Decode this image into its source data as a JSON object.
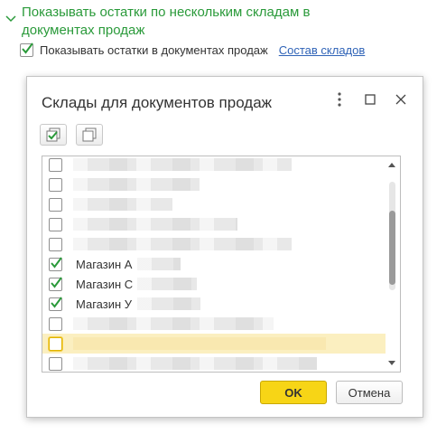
{
  "section": {
    "title": "Показывать остатки по нескольким складам в документах продаж",
    "expanded": true
  },
  "option": {
    "checked": true,
    "label": "Показывать остатки в документах продаж",
    "link": "Состав складов"
  },
  "dialog": {
    "title": "Склады для документов продаж",
    "toolbar": [
      "check-all-icon",
      "uncheck-all-icon"
    ],
    "rows": [
      {
        "checked": false,
        "label": ""
      },
      {
        "checked": false,
        "label": ""
      },
      {
        "checked": false,
        "label": ""
      },
      {
        "checked": false,
        "label": ""
      },
      {
        "checked": false,
        "label": ""
      },
      {
        "checked": true,
        "label": "Магазин А"
      },
      {
        "checked": true,
        "label": "Магазин С"
      },
      {
        "checked": true,
        "label": "Магазин У"
      },
      {
        "checked": false,
        "label": ""
      },
      {
        "checked": false,
        "label": "",
        "selected": true
      },
      {
        "checked": false,
        "label": ""
      }
    ],
    "ok_label": "OK",
    "cancel_label": "Отмена"
  },
  "colors": {
    "accent_green": "#2a9a3a",
    "link_blue": "#2f63b7",
    "ok_yellow": "#f7d516",
    "selection": "#fbefc0"
  }
}
